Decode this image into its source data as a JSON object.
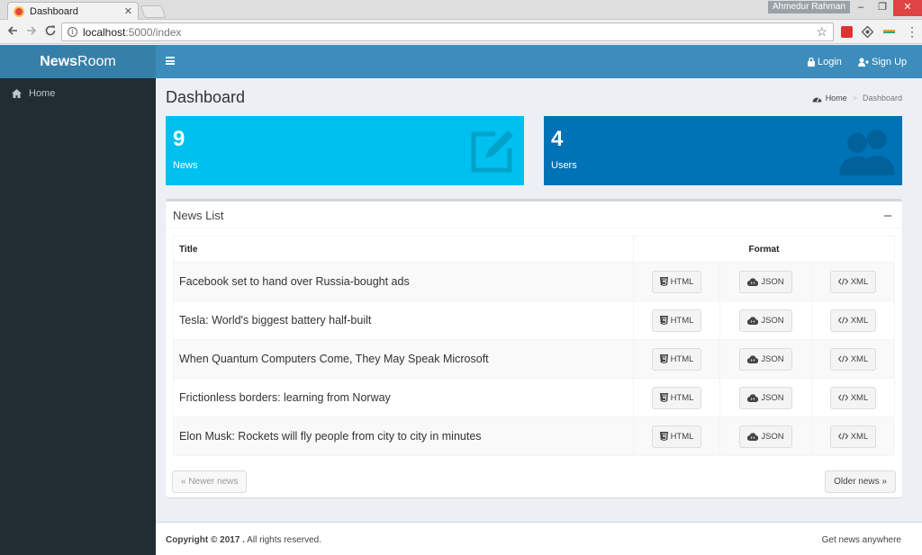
{
  "browser": {
    "tab_title": "Dashboard",
    "tab_close": "✕",
    "profile_name": "Ahmedur Rahman",
    "url_host": "localhost",
    "url_path": ":5000/index",
    "win_min": "–",
    "win_max": "❐",
    "win_close": "✕"
  },
  "sidebar": {
    "brand_bold": "News",
    "brand_rest": "Room",
    "items": [
      {
        "label": "Home",
        "icon": "home-icon"
      }
    ]
  },
  "navbar": {
    "login": "Login",
    "signup": "Sign Up"
  },
  "header": {
    "title": "Dashboard",
    "breadcrumb_home": "Home",
    "breadcrumb_current": "Dashboard"
  },
  "stats": {
    "news": {
      "count": "9",
      "label": "News",
      "color": "#00c0ef",
      "icon": "edit-icon"
    },
    "users": {
      "count": "4",
      "label": "Users",
      "color": "#0073b7",
      "icon": "users-icon"
    }
  },
  "news_list": {
    "title": "News List",
    "col_title": "Title",
    "col_format": "Format",
    "format_labels": {
      "html": "HTML",
      "json": "JSON",
      "xml": "XML"
    },
    "rows": [
      {
        "title": "Facebook set to hand over Russia-bought ads"
      },
      {
        "title": "Tesla: World's biggest battery half-built"
      },
      {
        "title": "When Quantum Computers Come, They May Speak Microsoft"
      },
      {
        "title": "Frictionless borders: learning from Norway"
      },
      {
        "title": "Elon Musk: Rockets will fly people from city to city in minutes"
      }
    ],
    "newer": "« Newer news",
    "older": "Older news »"
  },
  "footer": {
    "copyright": "Copyright © 2017 .",
    "rights": " All rights reserved.",
    "tagline": "Get news anywhere"
  },
  "colors": {
    "navbar": "#3c8dbc",
    "logo": "#367fa9",
    "sidebar": "#222d32"
  }
}
